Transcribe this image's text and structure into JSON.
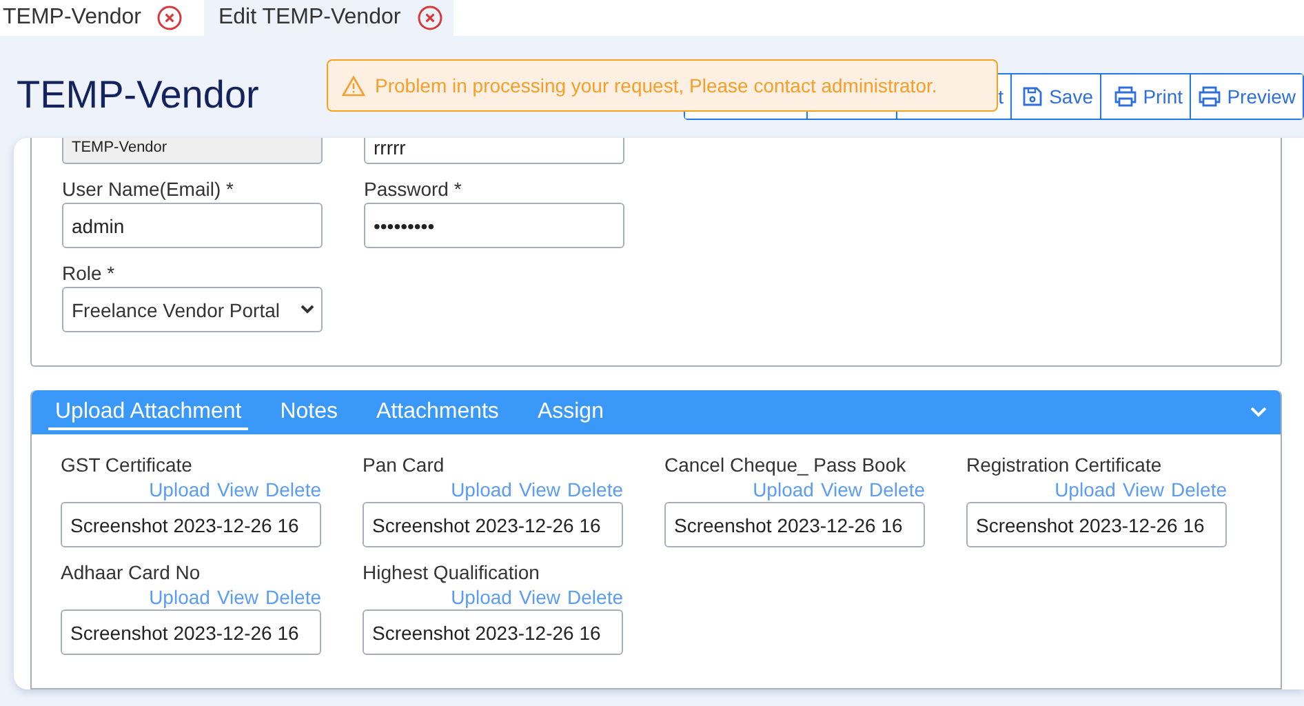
{
  "tabs": [
    {
      "label": "TEMP-Vendor",
      "selected": false
    },
    {
      "label": "Edit TEMP-Vendor",
      "selected": true
    }
  ],
  "page_title": "TEMP-Vendor",
  "toolbar": [
    {
      "kind": "covered"
    },
    {
      "kind": "covered"
    },
    {
      "kind": "text",
      "label": "t"
    },
    {
      "kind": "save",
      "label": "Save"
    },
    {
      "kind": "print",
      "label": "Print"
    },
    {
      "kind": "print",
      "label": "Preview"
    }
  ],
  "alert": {
    "message": "Problem in processing your request, Please contact administrator."
  },
  "form": {
    "top_fields": [
      {
        "value": "TEMP-Vendor",
        "disabled": true
      },
      {
        "value": "rrrrr",
        "disabled": false
      }
    ],
    "fields": [
      {
        "label": "User Name(Email) *",
        "value": "admin"
      },
      {
        "label": "Password *",
        "value": "•••••••••"
      }
    ],
    "role": {
      "label": "Role *",
      "value": "Freelance Vendor Portal"
    }
  },
  "panel": {
    "tabs": [
      {
        "label": "Upload Attachment",
        "selected": true
      },
      {
        "label": "Notes",
        "selected": false
      },
      {
        "label": "Attachments",
        "selected": false
      },
      {
        "label": "Assign",
        "selected": false
      }
    ],
    "attachments": [
      {
        "label": "GST Certificate",
        "actions": [
          "Upload",
          "View",
          "Delete"
        ],
        "file": "Screenshot 2023-12-26 16"
      },
      {
        "label": "Pan Card",
        "actions": [
          "Upload",
          "View",
          "Delete"
        ],
        "file": "Screenshot 2023-12-26 16"
      },
      {
        "label": "Cancel Cheque_ Pass Book",
        "actions": [
          "Upload",
          "View",
          "Delete"
        ],
        "file": "Screenshot 2023-12-26 16"
      },
      {
        "label": "Registration Certificate",
        "actions": [
          "Upload",
          "View",
          "Delete"
        ],
        "file": "Screenshot 2023-12-26 16"
      },
      {
        "label": "Adhaar Card No",
        "actions": [
          "Upload",
          "View",
          "Delete"
        ],
        "file": "Screenshot 2023-12-26 16"
      },
      {
        "label": "Highest Qualification",
        "actions": [
          "Upload",
          "View",
          "Delete"
        ],
        "file": "Screenshot 2023-12-26 16"
      }
    ]
  }
}
